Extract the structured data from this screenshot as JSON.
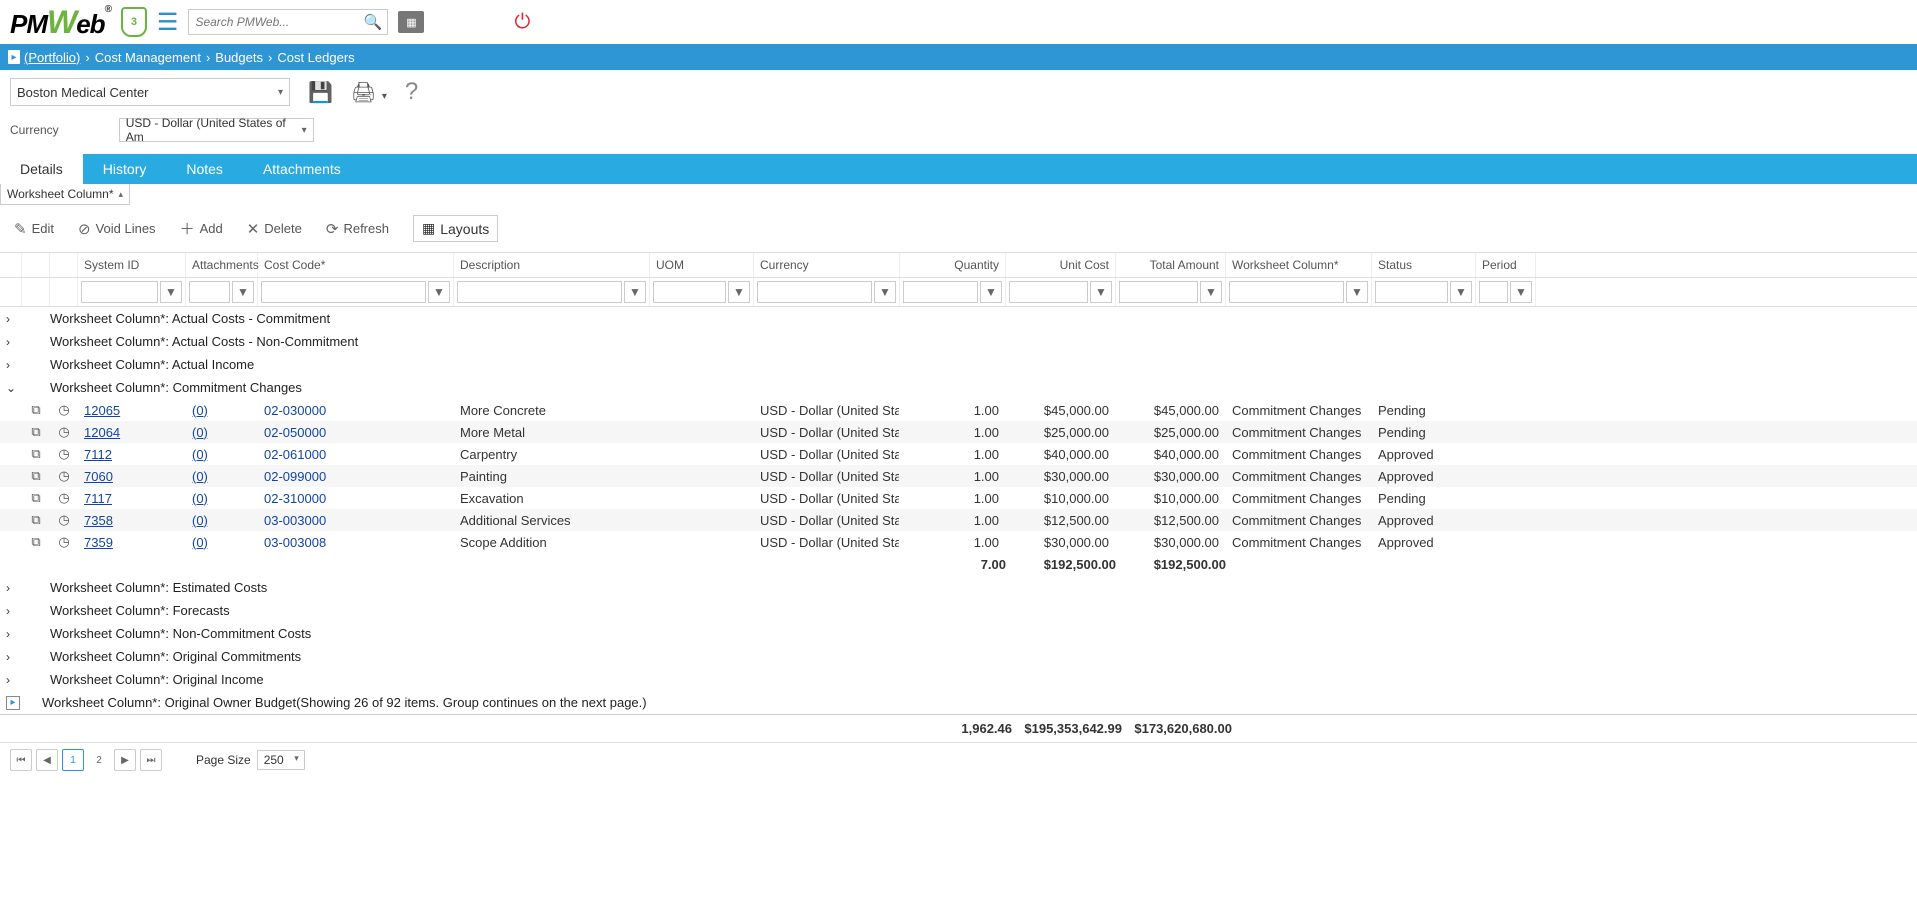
{
  "app_logo": {
    "pm": "PM",
    "w": "W",
    "eb": "eb",
    "r": "®"
  },
  "shield_count": "3",
  "search_placeholder": "Search PMWeb...",
  "breadcrumb": {
    "portfolio": "(Portfolio)",
    "cost": "Cost Management",
    "budgets": "Budgets",
    "ledger": "Cost Ledgers"
  },
  "project": "Boston Medical Center",
  "currency_label": "Currency",
  "currency_value": "USD - Dollar (United States of Am",
  "tabs": [
    "Details",
    "History",
    "Notes",
    "Attachments"
  ],
  "ws_dropdown": "Worksheet Column*",
  "toolbar": {
    "edit": "Edit",
    "void": "Void Lines",
    "add": "Add",
    "delete": "Delete",
    "refresh": "Refresh",
    "layouts": "Layouts"
  },
  "columns": {
    "sys": "System ID",
    "att": "Attachments",
    "code": "Cost Code*",
    "desc": "Description",
    "uom": "UOM",
    "cur": "Currency",
    "qty": "Quantity",
    "unit": "Unit Cost",
    "tot": "Total Amount",
    "wcol": "Worksheet Column*",
    "stat": "Status",
    "per": "Period"
  },
  "groups_before": [
    "Worksheet Column*: Actual Costs - Commitment",
    "Worksheet Column*: Actual Costs - Non-Commitment",
    "Worksheet Column*: Actual Income"
  ],
  "open_group": "Worksheet Column*: Commitment Changes",
  "rows": [
    {
      "sys": "12065",
      "att": "(0)",
      "code": "02-030000",
      "desc": "More Concrete",
      "cur": "USD - Dollar (United States",
      "qty": "1.00",
      "unit": "$45,000.00",
      "tot": "$45,000.00",
      "wcol": "Commitment Changes",
      "stat": "Pending"
    },
    {
      "sys": "12064",
      "att": "(0)",
      "code": "02-050000",
      "desc": "More Metal",
      "cur": "USD - Dollar (United States",
      "qty": "1.00",
      "unit": "$25,000.00",
      "tot": "$25,000.00",
      "wcol": "Commitment Changes",
      "stat": "Pending"
    },
    {
      "sys": "7112",
      "att": "(0)",
      "code": "02-061000",
      "desc": "Carpentry",
      "cur": "USD - Dollar (United States",
      "qty": "1.00",
      "unit": "$40,000.00",
      "tot": "$40,000.00",
      "wcol": "Commitment Changes",
      "stat": "Approved"
    },
    {
      "sys": "7060",
      "att": "(0)",
      "code": "02-099000",
      "desc": "Painting",
      "cur": "USD - Dollar (United States",
      "qty": "1.00",
      "unit": "$30,000.00",
      "tot": "$30,000.00",
      "wcol": "Commitment Changes",
      "stat": "Approved"
    },
    {
      "sys": "7117",
      "att": "(0)",
      "code": "02-310000",
      "desc": "Excavation",
      "cur": "USD - Dollar (United States",
      "qty": "1.00",
      "unit": "$10,000.00",
      "tot": "$10,000.00",
      "wcol": "Commitment Changes",
      "stat": "Pending"
    },
    {
      "sys": "7358",
      "att": "(0)",
      "code": "03-003000",
      "desc": "Additional Services",
      "cur": "USD - Dollar (United States",
      "qty": "1.00",
      "unit": "$12,500.00",
      "tot": "$12,500.00",
      "wcol": "Commitment Changes",
      "stat": "Approved"
    },
    {
      "sys": "7359",
      "att": "(0)",
      "code": "03-003008",
      "desc": "Scope Addition",
      "cur": "USD - Dollar (United States",
      "qty": "1.00",
      "unit": "$30,000.00",
      "tot": "$30,000.00",
      "wcol": "Commitment Changes",
      "stat": "Approved"
    }
  ],
  "subtotal": {
    "qty": "7.00",
    "unit": "$192,500.00",
    "tot": "$192,500.00"
  },
  "groups_after": [
    "Worksheet Column*: Estimated Costs",
    "Worksheet Column*: Forecasts",
    "Worksheet Column*: Non-Commitment Costs",
    "Worksheet Column*: Original Commitments",
    "Worksheet Column*: Original Income"
  ],
  "last_group": "Worksheet Column*: Original Owner Budget(Showing 26 of 92 items. Group continues on the next page.)",
  "grand": {
    "qty": "1,962.46",
    "unit": "$195,353,642.99",
    "tot": "$173,620,680.00"
  },
  "pager": {
    "pages": [
      "1",
      "2"
    ],
    "size_label": "Page Size",
    "size_val": "250"
  }
}
